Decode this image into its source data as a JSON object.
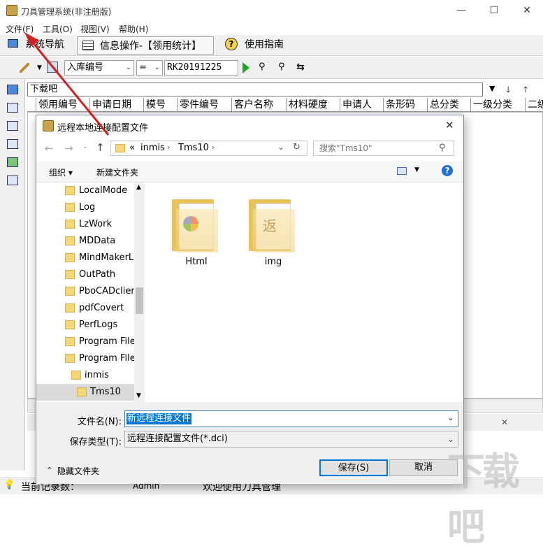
{
  "app": {
    "title": "刀具管理系统(非注册版)",
    "window_controls": {
      "minimize": "—",
      "maximize": "☐",
      "close": "✕"
    }
  },
  "menu": [
    "文件(F)",
    "工具(O)",
    "视图(V)",
    "帮助(H)"
  ],
  "toolbar": {
    "nav": "系统导航",
    "info": "信息操作-【领用统计】",
    "guide": "使用指南"
  },
  "query": {
    "field": "入库编号",
    "operator": "=",
    "value": "RK20191225"
  },
  "filter": {
    "text": "下载吧"
  },
  "grid": {
    "columns": [
      "领用编号",
      "申请日期",
      "模号",
      "零件编号",
      "客户名称",
      "材料硬度",
      "申请人",
      "条形码",
      "总分类",
      "一级分类",
      "二级"
    ]
  },
  "status": {
    "left": "当前记录数：",
    "user": "Admin",
    "welcome": "欢迎使用刀具管理"
  },
  "dialog": {
    "title": "远程本地连接配置文件",
    "breadcrumb": {
      "prefix": "«",
      "parts": [
        "inmis",
        "Tms10"
      ]
    },
    "search_placeholder": "搜索\"Tms10\"",
    "organize": "组织 ▾",
    "new_folder": "新建文件夹",
    "tree": [
      "LocalMode",
      "Log",
      "LzWork",
      "MDData",
      "MindMakerLc",
      "OutPath",
      "PboCADclient",
      "pdfCovert",
      "PerfLogs",
      "Program Files",
      "Program Files",
      "inmis",
      "Tms10"
    ],
    "files": [
      {
        "name": "Html"
      },
      {
        "name": "img"
      }
    ],
    "filename_label": "文件名(N):",
    "filename_value": "新远程连接文件",
    "filetype_label": "保存类型(T):",
    "filetype_value": "远程连接配置文件(*.dci)",
    "hide_folders": "隐藏文件夹",
    "save": "保存(S)",
    "cancel": "取消"
  },
  "watermark": "下载吧",
  "colors": {
    "accent": "#0078d7",
    "arrow": "#d62020",
    "folder": "#f2cf72"
  }
}
